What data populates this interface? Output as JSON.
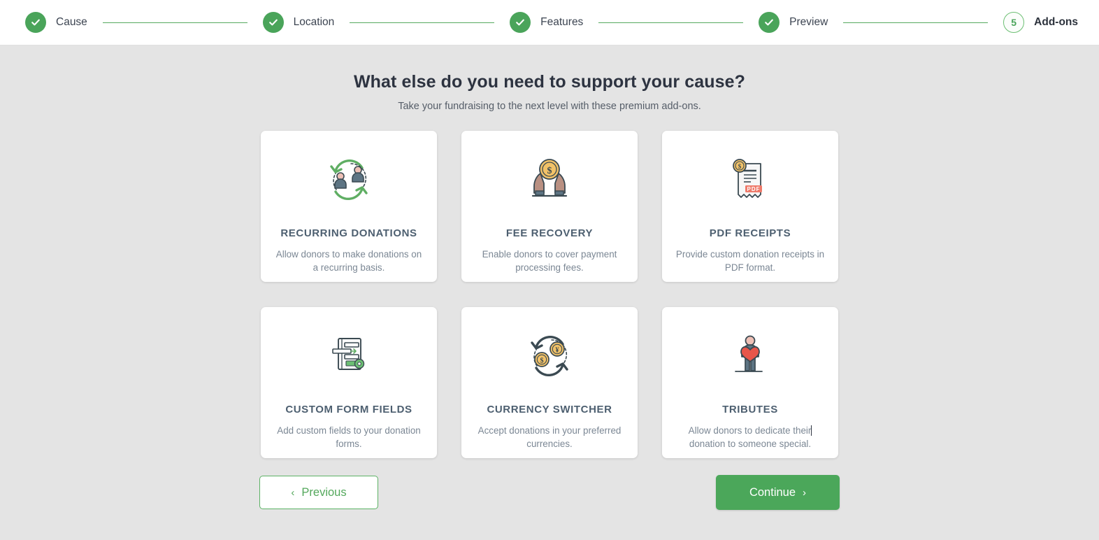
{
  "stepper": {
    "steps": [
      {
        "label": "Cause",
        "state": "done",
        "marker": "check"
      },
      {
        "label": "Location",
        "state": "done",
        "marker": "check"
      },
      {
        "label": "Features",
        "state": "done",
        "marker": "check"
      },
      {
        "label": "Preview",
        "state": "done",
        "marker": "check"
      },
      {
        "label": "Add-ons",
        "state": "active",
        "marker": "5"
      }
    ]
  },
  "main": {
    "headline": "What else do you need to support your cause?",
    "subhead": "Take your fundraising to the next level with these premium add-ons.",
    "cards": [
      {
        "icon": "recurring-donations-icon",
        "title": "RECURRING DONATIONS",
        "desc": "Allow donors to make donations on a recurring basis."
      },
      {
        "icon": "fee-recovery-icon",
        "title": "FEE RECOVERY",
        "desc": "Enable donors to cover payment processing fees."
      },
      {
        "icon": "pdf-receipts-icon",
        "title": "PDF RECEIPTS",
        "desc": "Provide custom donation receipts in PDF format.",
        "badge": "PDF"
      },
      {
        "icon": "custom-form-fields-icon",
        "title": "CUSTOM FORM FIELDS",
        "desc": "Add custom fields to your donation forms."
      },
      {
        "icon": "currency-switcher-icon",
        "title": "CURRENCY SWITCHER",
        "desc": "Accept donations in your preferred currencies."
      },
      {
        "icon": "tributes-icon",
        "title": "TRIBUTES",
        "desc_part1": "Allow donors to dedicate their",
        "desc_part2": "donation to someone special.",
        "has_caret": true
      }
    ]
  },
  "actions": {
    "previous_label": "Previous",
    "previous_chevron": "‹",
    "continue_label": "Continue",
    "continue_chevron": "›"
  },
  "colors": {
    "green": "#4aa45a",
    "green_line": "#56a95f",
    "page_bg": "#e4e4e4",
    "card_bg": "#ffffff",
    "title": "#4d5f70",
    "desc": "#7b8794",
    "badge_red": "#ef7b6b",
    "coin_gold": "#f0b95c"
  }
}
